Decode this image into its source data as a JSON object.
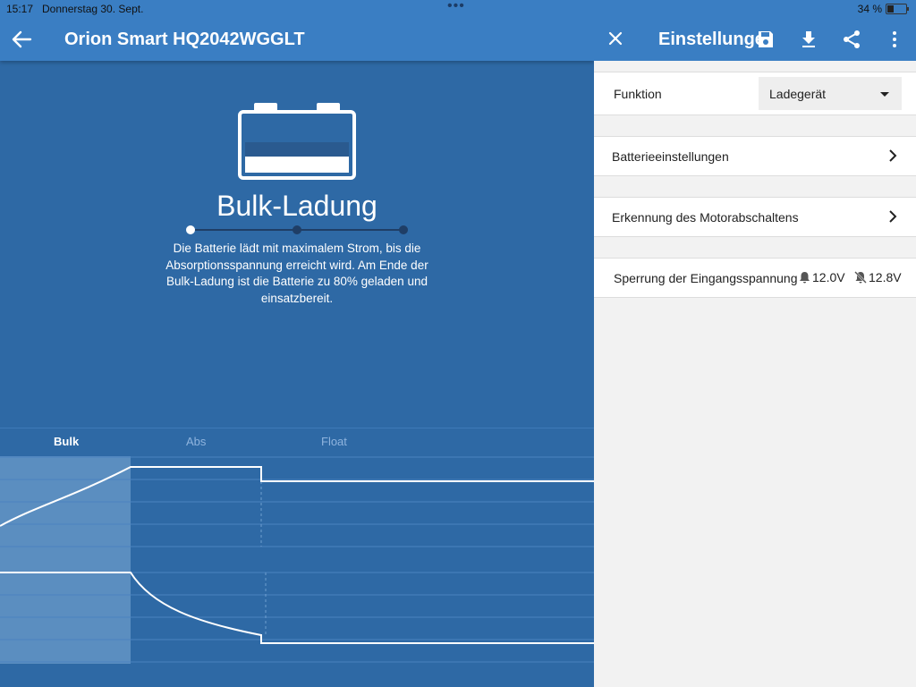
{
  "status": {
    "time": "15:17",
    "date": "Donnerstag 30. Sept.",
    "battery": "34 %"
  },
  "left": {
    "title": "Orion Smart HQ2042WGGLT",
    "state_title": "Bulk-Ladung",
    "description": "Die Batterie lädt mit maximalem Strom, bis die Absorptionsspannung erreicht wird. Am Ende der Bulk-Ladung ist die Batterie zu 80% geladen und einsatzbereit.",
    "progress": {
      "steps": 3,
      "active_index": 0
    },
    "chart_tabs": [
      "Bulk",
      "Abs",
      "Float"
    ]
  },
  "right": {
    "title": "Einstellungen",
    "rows": {
      "function_label": "Funktion",
      "function_value": "Ladegerät",
      "battery_settings": "Batterieeinstellungen",
      "engine_detect": "Erkennung des Motorabschaltens",
      "input_lock": "Sperrung der Eingangsspannung",
      "volt_on": "12.0V",
      "volt_off": "12.8V"
    }
  },
  "colors": {
    "accent": "#3a7ec3",
    "panel": "#2e69a5",
    "white": "#ffffff"
  },
  "icons": [
    "back-arrow-icon",
    "close-icon",
    "save-icon",
    "download-icon",
    "share-icon",
    "more-vert-icon",
    "chevron-right-icon",
    "bell-icon",
    "bell-off-icon",
    "battery-icon"
  ]
}
